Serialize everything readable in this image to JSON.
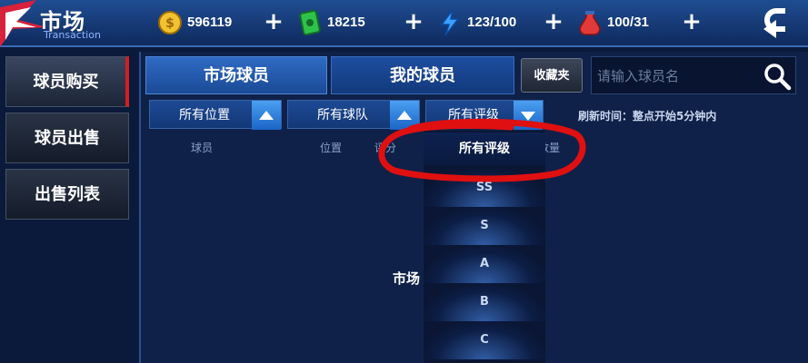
{
  "header": {
    "title": "市场",
    "subtitle": "Transaction",
    "resources": [
      {
        "name": "gold",
        "value": "596119",
        "color": "#f2c230"
      },
      {
        "name": "cash",
        "value": "18215",
        "color": "#2fc24a"
      },
      {
        "name": "energy",
        "value": "123/100",
        "color": "#3aa0ff"
      },
      {
        "name": "stamina",
        "value": "100/31",
        "color": "#e23a3a"
      }
    ],
    "plus_label": "+"
  },
  "sidebar": {
    "items": [
      {
        "label": "球员购买",
        "active": true
      },
      {
        "label": "球员出售",
        "active": false
      },
      {
        "label": "出售列表",
        "active": false
      }
    ]
  },
  "main": {
    "tabs": [
      {
        "label": "市场球员"
      },
      {
        "label": "我的球员"
      }
    ],
    "favorites_label": "收藏夹",
    "search": {
      "placeholder": "请输入球员名",
      "value": ""
    },
    "filters": [
      {
        "label": "所有位置"
      },
      {
        "label": "所有球队"
      },
      {
        "label": "所有评级"
      }
    ],
    "refresh_text": "刷新时间：整点开始5分钟内",
    "columns": [
      "球员",
      "位置",
      "评分",
      "数量"
    ],
    "center_text": "市场"
  },
  "rating_dropdown": {
    "selected": "所有评级",
    "options": [
      "SS",
      "S",
      "A",
      "B",
      "C"
    ]
  },
  "colors": {
    "highlight_ring": "#e01010",
    "accent_blue": "#2f6bc4"
  }
}
